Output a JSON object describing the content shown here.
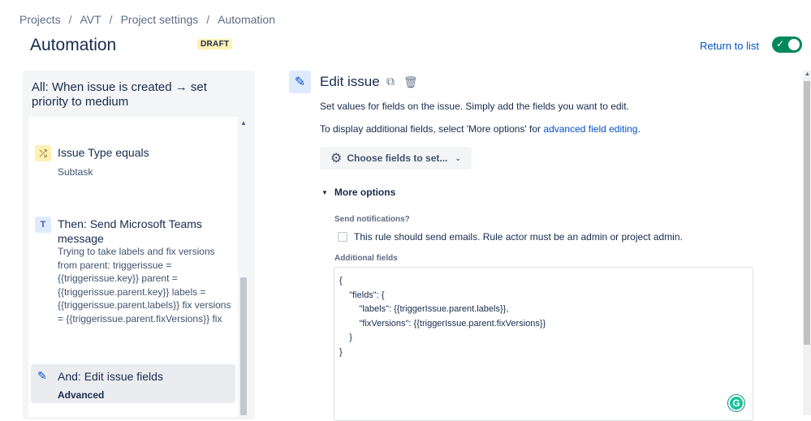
{
  "breadcrumbs": [
    "Projects",
    "AVT",
    "Project settings",
    "Automation"
  ],
  "header": {
    "title": "Automation",
    "badge": "DRAFT",
    "return_label": "Return to list",
    "enabled_icon": "check-icon"
  },
  "rule": {
    "title": "All: When issue is created → set priority to medium",
    "steps": [
      {
        "icon": "shuffle-icon",
        "title": "Issue Type equals",
        "subtitle": "Subtask"
      },
      {
        "icon": "teams-icon",
        "title": "Then: Send Microsoft Teams message",
        "description": "Trying to take labels and fix versions from parent: triggerissue = {{triggerissue.key}} parent = {{triggerissue.parent.key}} labels = {{triggerissue.parent.labels}} fix versions = {{triggerissue.parent.fixVersions}} fix"
      },
      {
        "icon": "pencil-icon",
        "title": "And: Edit issue fields",
        "subtitle": "Advanced"
      }
    ]
  },
  "editor": {
    "title": "Edit issue",
    "desc1": "Set values for fields on the issue. Simply add the fields you want to edit.",
    "desc2_prefix": "To display additional fields, select 'More options' for ",
    "desc2_link": "advanced field editing",
    "desc2_suffix": ".",
    "choose_fields": "Choose fields to set...",
    "more_options": "More options",
    "send_notifications_label": "Send notifications?",
    "send_notifications_text": "This rule should send emails. Rule actor must be an admin or project admin.",
    "additional_fields_label": "Additional fields",
    "code_lines": [
      "{",
      "    \"fields\": {",
      "        \"labels\": {{triggerIssue.parent.labels}},",
      "        \"fixVersions\": {{triggerIssue.parent.fixVersions}}",
      "    }",
      "}"
    ]
  },
  "colors": {
    "accent": "#0052cc",
    "toggle_on": "#00875a",
    "badge_bg": "#fff0b3"
  }
}
